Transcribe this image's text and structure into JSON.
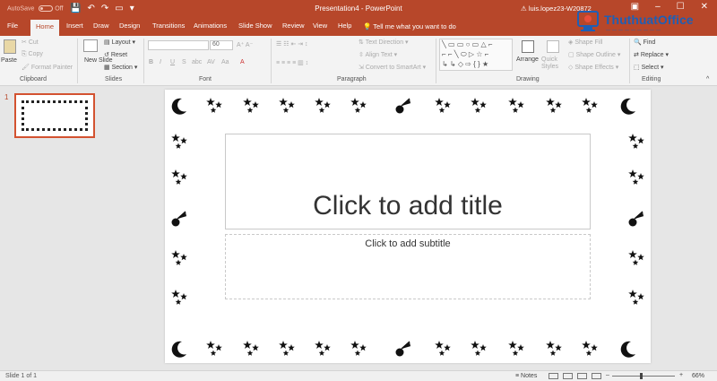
{
  "titlebar": {
    "autosave": "AutoSave",
    "autosave_state": "Off",
    "document_title": "Presentation4 - PowerPoint",
    "user": "luis.lopez23-W20872",
    "qat_icons": [
      "save-icon",
      "undo-icon",
      "redo-icon",
      "start-presentation-icon",
      "customize-qat-icon"
    ]
  },
  "tabs": {
    "items": [
      "File",
      "Home",
      "Insert",
      "Draw",
      "Design",
      "Transitions",
      "Animations",
      "Slide Show",
      "Review",
      "View",
      "Help"
    ],
    "active": "Home",
    "tell_me": "Tell me what you want to do"
  },
  "ribbon": {
    "clipboard": {
      "label": "Clipboard",
      "paste": "Paste",
      "cut": "Cut",
      "copy": "Copy",
      "format_painter": "Format Painter"
    },
    "slides": {
      "label": "Slides",
      "new_slide": "New Slide",
      "layout": "Layout",
      "reset": "Reset",
      "section": "Section"
    },
    "font": {
      "label": "Font",
      "font_name": "",
      "font_size": "60",
      "bold": "B",
      "italic": "I",
      "underline": "U",
      "strike": "S",
      "shadow": "abc",
      "spacing": "AV",
      "case": "Aa",
      "color": "A"
    },
    "paragraph": {
      "label": "Paragraph",
      "text_direction": "Text Direction",
      "align_text": "Align Text",
      "convert_smartart": "Convert to SmartArt"
    },
    "drawing": {
      "label": "Drawing",
      "arrange": "Arrange",
      "quick_styles": "Quick Styles",
      "shape_fill": "Shape Fill",
      "shape_outline": "Shape Outline",
      "shape_effects": "Shape Effects"
    },
    "editing": {
      "label": "Editing",
      "find": "Find",
      "replace": "Replace",
      "select": "Select"
    }
  },
  "slides_pane": {
    "slide_number": "1"
  },
  "slide": {
    "title_placeholder": "Click to add title",
    "subtitle_placeholder": "Click to add subtitle"
  },
  "statusbar": {
    "slide_info": "Slide 1 of 1",
    "notes": "Notes",
    "zoom": "66%"
  },
  "watermark": {
    "brand": "ThuthuatOffice"
  },
  "colors": {
    "accent": "#b7472a",
    "thumb_border": "#d35230"
  }
}
